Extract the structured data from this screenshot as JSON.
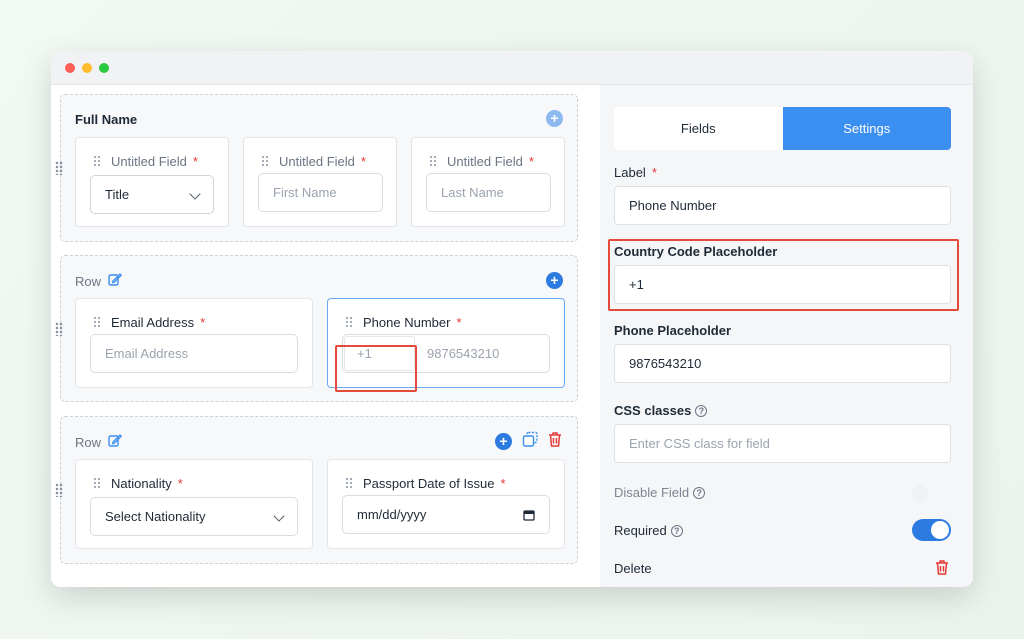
{
  "builder": {
    "group1": {
      "title": "Full Name",
      "fields": [
        {
          "label": "Untitled Field",
          "required_mark": "*",
          "select_value": "Title"
        },
        {
          "label": "Untitled Field",
          "required_mark": "*",
          "placeholder": "First Name"
        },
        {
          "label": "Untitled Field",
          "required_mark": "*",
          "placeholder": "Last Name"
        }
      ]
    },
    "group2": {
      "row_label": "Row",
      "email": {
        "label": "Email Address",
        "required_mark": "*",
        "placeholder": "Email Address"
      },
      "phone": {
        "label": "Phone Number",
        "required_mark": "*",
        "code_placeholder": "+1",
        "phone_placeholder": "9876543210"
      }
    },
    "group3": {
      "row_label": "Row",
      "nationality": {
        "label": "Nationality",
        "required_mark": "*",
        "select_value": "Select Nationality"
      },
      "passport": {
        "label": "Passport Date of Issue",
        "required_mark": "*",
        "date_placeholder": "mm/dd/yyyy"
      }
    }
  },
  "settings": {
    "tabs": [
      "Fields",
      "Settings"
    ],
    "active_tab": "Settings",
    "label_title": "Label",
    "required_mark": "*",
    "label_value": "Phone Number",
    "country_code_title": "Country Code Placeholder",
    "country_code_value": "+1",
    "phone_placeholder_title": "Phone Placeholder",
    "phone_placeholder_value": "9876543210",
    "css_classes_title": "CSS classes",
    "css_classes_placeholder": "Enter CSS class for field",
    "disable_field_title": "Disable Field",
    "required_title": "Required",
    "delete_title": "Delete",
    "help_glyph": "?"
  },
  "colors": {
    "accent": "#3b8ff0",
    "highlight": "#e64a3b",
    "required": "#e53935",
    "delete": "#e53935"
  }
}
